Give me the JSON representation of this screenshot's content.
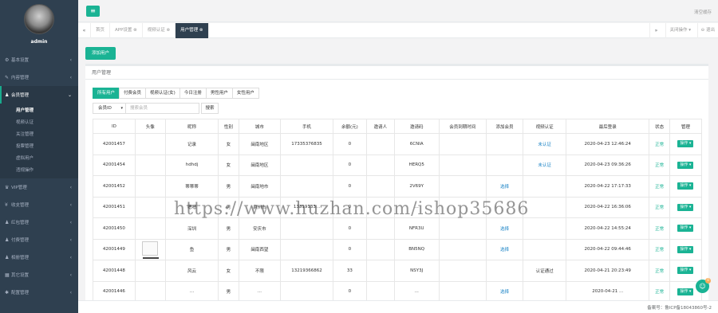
{
  "sidebar": {
    "username": "admin",
    "items": [
      {
        "icon": "⚙",
        "label": "基本设置"
      },
      {
        "icon": "✎",
        "label": "内容管理"
      },
      {
        "icon": "♟",
        "label": "会员管理"
      },
      {
        "icon": "♛",
        "label": "VIP管理"
      },
      {
        "icon": "¥",
        "label": "收支管理"
      },
      {
        "icon": "♟",
        "label": "红包管理"
      },
      {
        "icon": "♟",
        "label": "付费管理"
      },
      {
        "icon": "♟",
        "label": "相册管理"
      },
      {
        "icon": "▦",
        "label": "其它设置"
      },
      {
        "icon": "✱",
        "label": "配置管理"
      }
    ],
    "submenu": [
      "用户管理",
      "视频认证",
      "关注管理",
      "投票管理",
      "虚拟用户",
      "违规操作"
    ]
  },
  "topbar": {
    "menu_icon": "≡",
    "clear_cache": "清空缓存"
  },
  "tabs": {
    "prev": "«",
    "next": "»",
    "items": [
      "首页",
      "APP设置 ⊗",
      "视频认证 ⊗",
      "用户管理 ⊗"
    ],
    "close_ops": "关闭操作 ▾",
    "logout": "⊖ 退出"
  },
  "content": {
    "add_button": "添加用户",
    "panel_title": "用户管理",
    "filter_tabs": [
      "所有用户",
      "付费会员",
      "视频认证(女)",
      "今日注册",
      "男性用户",
      "女性用户"
    ],
    "search": {
      "field": "会员ID",
      "placeholder": "搜索会员",
      "button": "搜索"
    },
    "columns": [
      "ID",
      "头像",
      "昵称",
      "性别",
      "城市",
      "手机",
      "余额(元)",
      "邀请人",
      "邀请码",
      "会员到期时间",
      "添加会员",
      "视频认证",
      "最后登录",
      "状态",
      "管理"
    ],
    "rows": [
      {
        "id": "42001457",
        "avatar": "",
        "nick": "记录",
        "sex": "女",
        "city": "闽南地区",
        "phone": "17335376835",
        "balance": "0",
        "inviter": "",
        "code": "6CNIA",
        "expire": "",
        "add_vip": "",
        "verify": "未认证",
        "last": "2020-04-23 12:46:24",
        "status": "正常",
        "op": "操作 ▾"
      },
      {
        "id": "42001454",
        "avatar": "",
        "nick": "hdhdj",
        "sex": "女",
        "city": "闽南地区",
        "phone": "",
        "balance": "0",
        "inviter": "",
        "code": "HERQ5",
        "expire": "",
        "add_vip": "",
        "verify": "未认证",
        "last": "2020-04-23 09:36:26",
        "status": "正常",
        "op": "操作 ▾"
      },
      {
        "id": "42001452",
        "avatar": "",
        "nick": "蒂蒂蒂",
        "sex": "男",
        "city": "闽南地市",
        "phone": "",
        "balance": "0",
        "inviter": "",
        "code": "2V69Y",
        "expire": "",
        "add_vip": "选择",
        "verify": "",
        "last": "2020-04-22 17:17:33",
        "status": "正常",
        "op": "操作 ▾"
      },
      {
        "id": "42001451",
        "avatar": "",
        "nick": "嗯嗯",
        "sex": "男",
        "city": "泉州市",
        "phone": "13319133...",
        "balance": "0",
        "inviter": "",
        "code": "...",
        "expire": "",
        "add_vip": "",
        "verify": "",
        "last": "2020-04-22 16:36:06",
        "status": "正常",
        "op": "操作 ▾"
      },
      {
        "id": "42001450",
        "avatar": "",
        "nick": "深圳",
        "sex": "男",
        "city": "安庆市",
        "phone": "",
        "balance": "0",
        "inviter": "",
        "code": "NFR3U",
        "expire": "",
        "add_vip": "选择",
        "verify": "",
        "last": "2020-04-22 14:55:24",
        "status": "正常",
        "op": "操作 ▾"
      },
      {
        "id": "42001449",
        "avatar": "thumb",
        "nick": "鱼",
        "sex": "男",
        "city": "闽南西望",
        "phone": "",
        "balance": "0",
        "inviter": "",
        "code": "BN5NQ",
        "expire": "",
        "add_vip": "选择",
        "verify": "",
        "last": "2020-04-22 09:44:46",
        "status": "正常",
        "op": "操作 ▾"
      },
      {
        "id": "42001448",
        "avatar": "",
        "nick": "风云",
        "sex": "女",
        "city": "不限",
        "phone": "13219366862",
        "balance": "33",
        "inviter": "",
        "code": "NSY3J",
        "expire": "",
        "add_vip": "",
        "verify": "认证通过",
        "last": "2020-04-21 20:23:49",
        "status": "正常",
        "op": "操作 ▾"
      },
      {
        "id": "42001446",
        "avatar": "",
        "nick": "...",
        "sex": "男",
        "city": "...",
        "phone": "",
        "balance": "0",
        "inviter": "",
        "code": "...",
        "expire": "",
        "add_vip": "选择",
        "verify": "",
        "last": "2020-04-21 ...",
        "status": "正常",
        "op": "操作 ▾"
      }
    ]
  },
  "footer": {
    "icp": "备案号：鲁ICP备18043860号-2"
  },
  "watermark": "https://www.huzhan.com/ishop35686",
  "chat": {
    "icon": "☺",
    "badge": "0"
  },
  "colors": {
    "accent": "#1ab394",
    "sidebar": "#2f4050",
    "link": "#1c84c6"
  }
}
